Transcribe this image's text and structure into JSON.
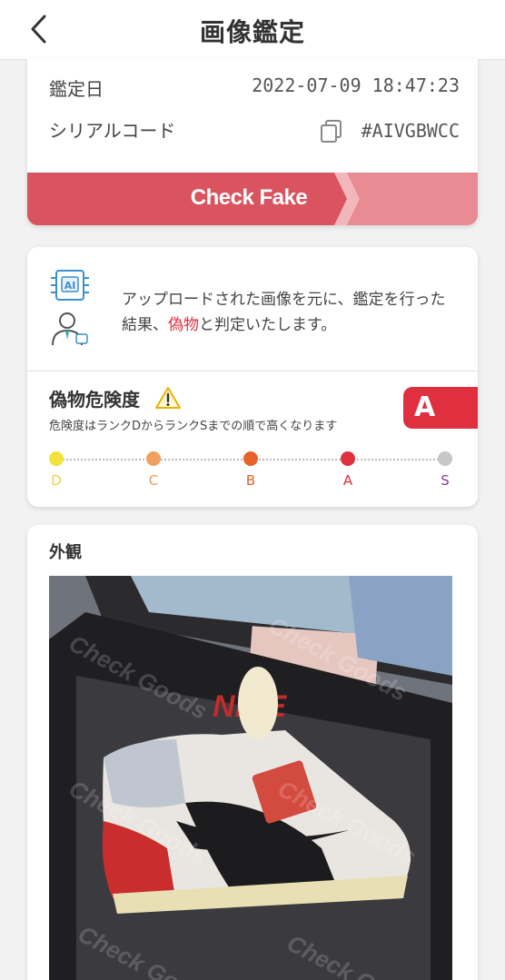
{
  "header": {
    "title": "画像鑑定"
  },
  "info": {
    "date_label": "鑑定日",
    "date_value": "2022-07-09 18:47:23",
    "serial_label": "シリアルコード",
    "serial_value": "#AIVGBWCC"
  },
  "result": {
    "label": "Check Fake",
    "color": "#d9545f"
  },
  "description": {
    "part1": "アップロードされた画像を元に、鑑定を行った結果、",
    "highlight": "偽物",
    "part2": "と判定いたします。"
  },
  "risk": {
    "title": "偽物危険度",
    "rank": "A",
    "desc": "危険度はランクDからランクSまでの順で高くなります",
    "levels": [
      {
        "label": "D",
        "color": "#f2e23a",
        "text_color": "#e8d630"
      },
      {
        "label": "C",
        "color": "#f0a060",
        "text_color": "#e89a58"
      },
      {
        "label": "B",
        "color": "#e8622a",
        "text_color": "#e0602a"
      },
      {
        "label": "A",
        "color": "#e0303f",
        "text_color": "#e0303f"
      },
      {
        "label": "S",
        "color": "#c7c7c7",
        "text_color": "#8a3a9a"
      }
    ]
  },
  "appearance": {
    "title": "外観"
  }
}
